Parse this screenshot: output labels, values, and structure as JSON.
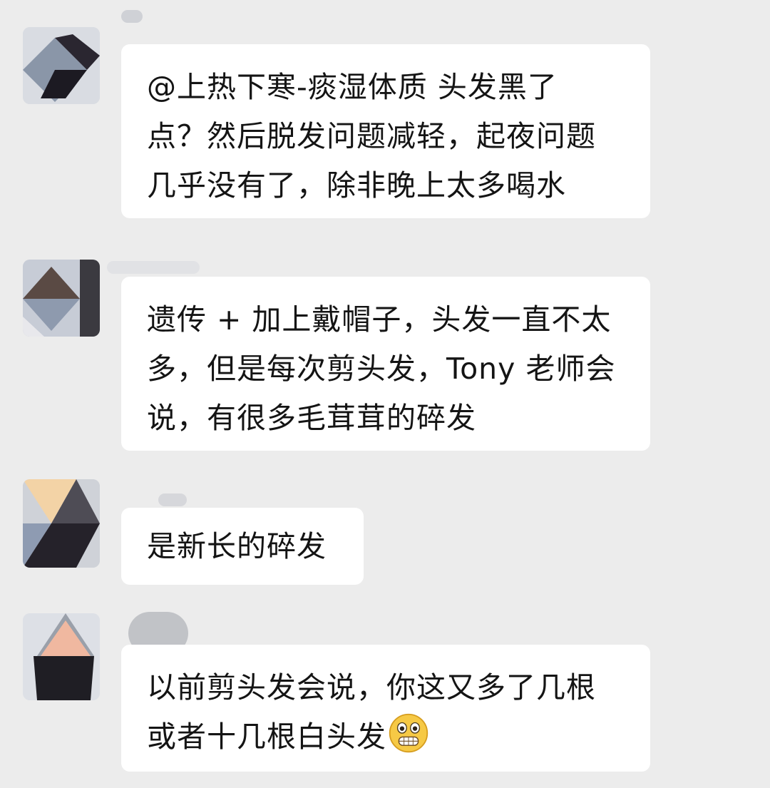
{
  "messages": [
    {
      "lines": [
        "@上热下寒-痰湿体质  头发黑了",
        "点？然后脱发问题减轻，起夜问题",
        "几乎没有了，除非晚上太多喝水"
      ]
    },
    {
      "lines": [
        "遗传 + 加上戴帽子，头发一直不太",
        "多，但是每次剪头发，Tony 老师会",
        "说，有很多毛茸茸的碎发"
      ]
    },
    {
      "lines": [
        "是新长的碎发"
      ]
    },
    {
      "lines": [
        "以前剪头发会说，你这又多了几根",
        "或者十几根白头发"
      ],
      "trailing_emoji": "grimacing-face-emoji"
    }
  ],
  "colors": {
    "background": "#ececec",
    "bubble": "#ffffff",
    "text": "#141414"
  }
}
